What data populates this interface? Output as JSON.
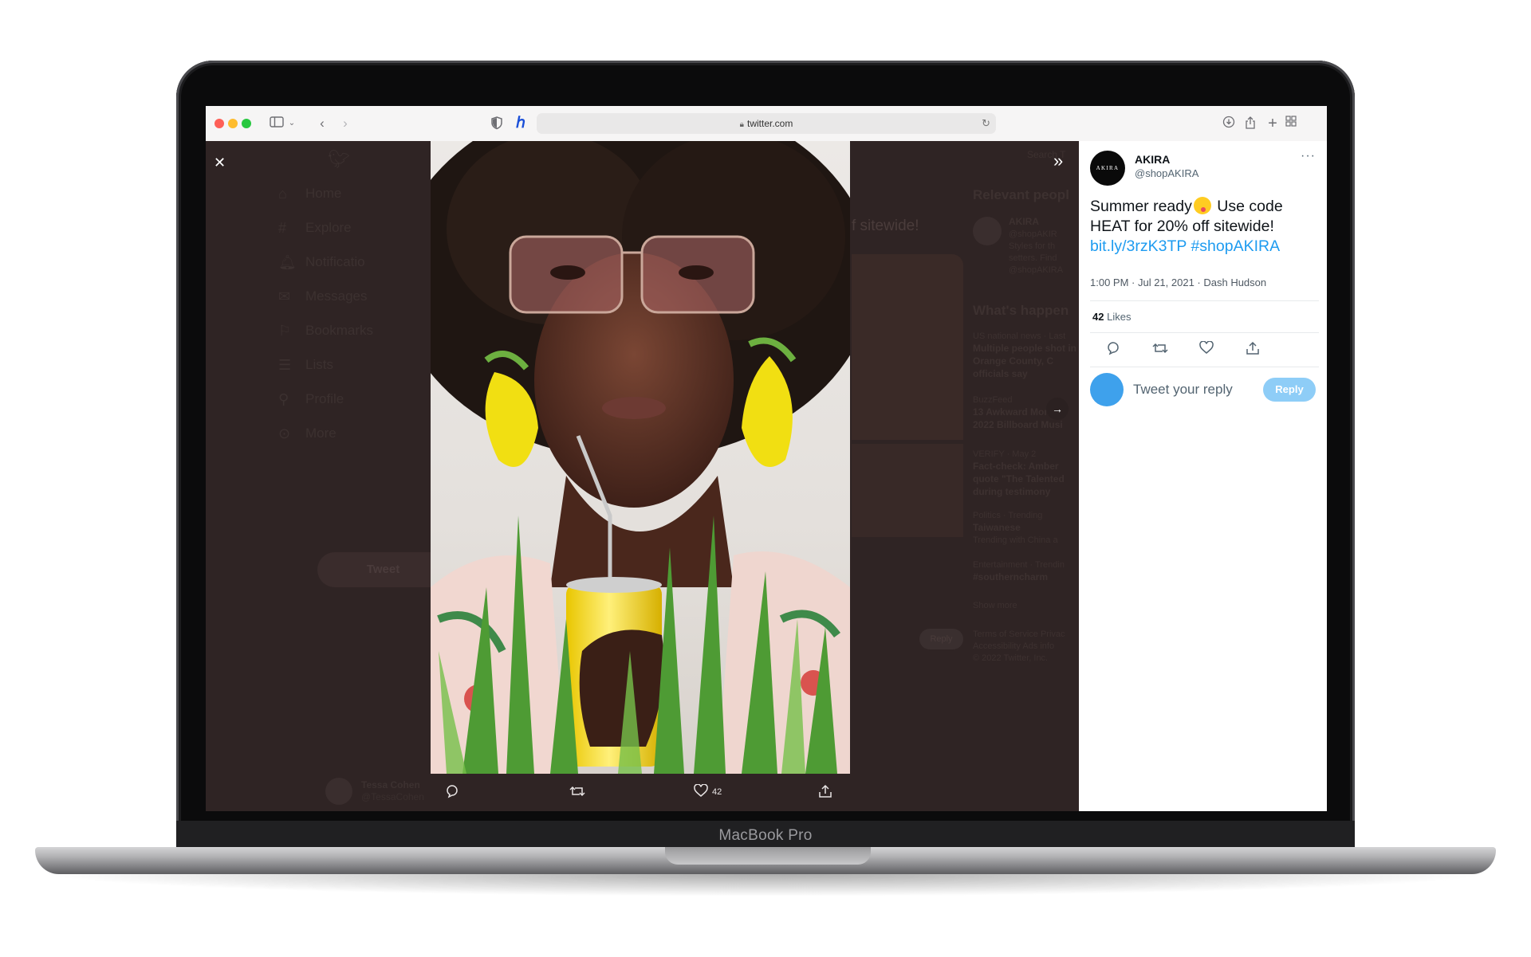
{
  "device": {
    "brand_label": "MacBook Pro"
  },
  "browser": {
    "url": "twitter.com"
  },
  "background_twitter": {
    "nav": [
      "Home",
      "Explore",
      "Notificatio",
      "Messages",
      "Bookmarks",
      "Lists",
      "Profile",
      "More"
    ],
    "tweet_button": "Tweet",
    "partial_tweet_text": "f sitewide!",
    "search_placeholder": "Search T",
    "relevant_heading": "Relevant peopl",
    "relevant_name": "AKIRA",
    "relevant_handle": "@shopAKIR",
    "relevant_bio_1": "Styles for th",
    "relevant_bio_2": "setters. Find",
    "relevant_bio_3": "@shopAKIRA",
    "happening_heading": "What's happen",
    "trends": [
      {
        "meta": "US national news · Last",
        "title": "Multiple people shot in Orange County, C officials say"
      },
      {
        "meta": "BuzzFeed",
        "title": "13 Awkward Moment 2022 Billboard Musi"
      },
      {
        "meta": "VERIFY · May 2",
        "title": "Fact-check: Amber quote \"The Talented during testimony"
      },
      {
        "meta": "Politics · Trending",
        "title": "Taiwanese",
        "sub": "Trending with China a"
      },
      {
        "meta": "Entertainment · Trendin",
        "title": "#southerncharm"
      }
    ],
    "show_more": "Show more",
    "footer_1": "Terms of Service   Privac",
    "footer_2": "Accessibility   Ads info",
    "footer_3": "© 2022 Twitter, Inc.",
    "account_name": "Tessa Cohen",
    "account_handle": "@TessaCohen",
    "reply_partial": "Reply"
  },
  "media_viewer": {
    "like_count": "42"
  },
  "tweet": {
    "author_name": "AKIRA",
    "author_handle": "@shopAKIRA",
    "avatar_text": "AKIRA",
    "more_label": "···",
    "text_1": "Summer ready",
    "text_2": " Use code HEAT for 20% off sitewide!",
    "link": "bit.ly/3rzK3TP",
    "hashtag": "#shopAKIRA",
    "meta": "1:00 PM · Jul 21, 2021 · Dash Hudson",
    "likes_count": "42",
    "likes_label": "Likes",
    "reply_placeholder": "Tweet your reply",
    "reply_button": "Reply"
  },
  "colors": {
    "twitter_blue": "#1d9bf0",
    "reply_button": "#8ecdf7",
    "dim_background": "#2f2424"
  }
}
